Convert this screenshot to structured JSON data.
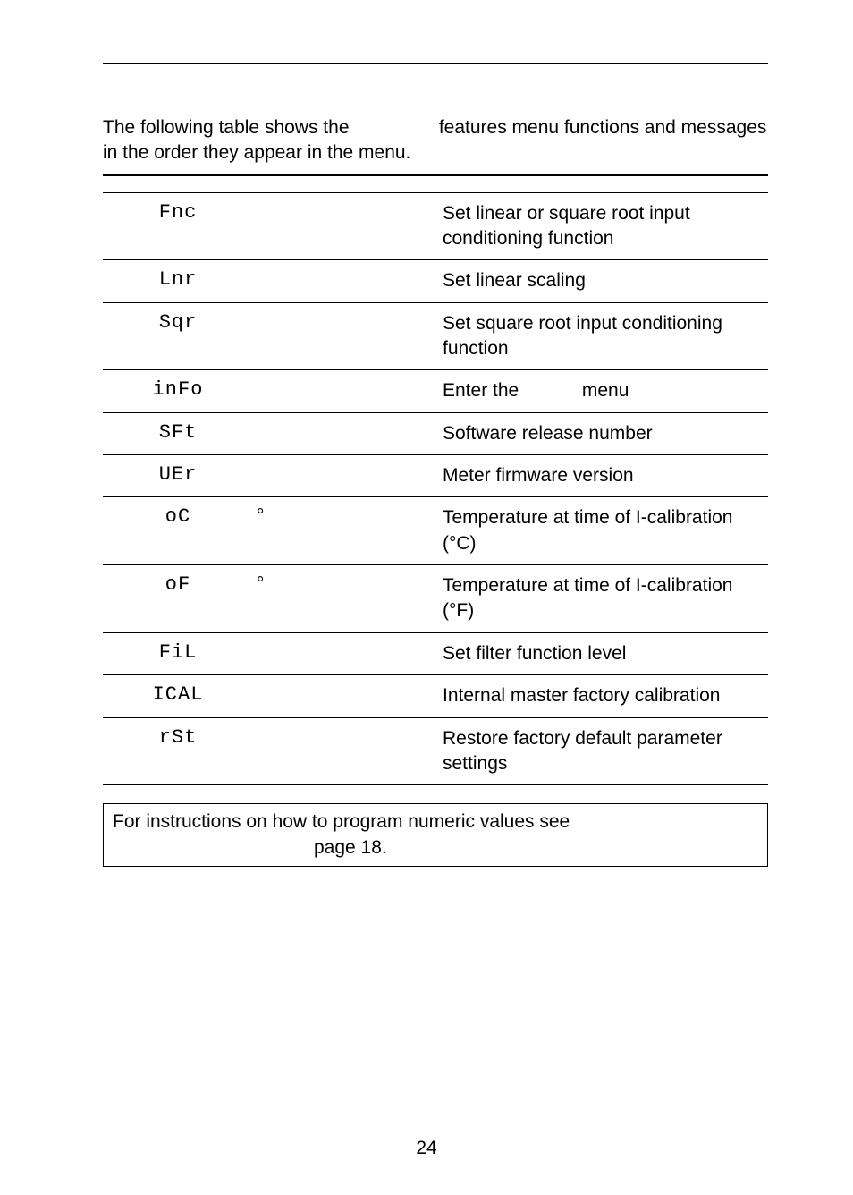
{
  "intro": {
    "line1_left": "The following table shows the",
    "line1_right": "features menu functions and messages",
    "line2": "in the order they appear in the menu."
  },
  "rows": [
    {
      "disp": "Fnc",
      "mid": "",
      "desc": "Set linear or square root input conditioning function"
    },
    {
      "disp": "Lnr",
      "mid": "",
      "desc": "Set linear scaling"
    },
    {
      "disp": "Sqr",
      "mid": "",
      "desc": "Set square root input conditioning function"
    },
    {
      "disp": "inFo",
      "mid": "",
      "desc_pre": "Enter the",
      "desc_post": "menu"
    },
    {
      "disp": "SFt",
      "mid": "",
      "desc": "Software release number"
    },
    {
      "disp": "UEr",
      "mid": "",
      "desc": "Meter firmware version"
    },
    {
      "disp": "oC",
      "mid": "°",
      "desc": "Temperature at time of I-calibration (°C)"
    },
    {
      "disp": "oF",
      "mid": "°",
      "desc": "Temperature at time of I-calibration (°F)"
    },
    {
      "disp": "FiL",
      "mid": "",
      "desc": "Set filter function level"
    },
    {
      "disp": "ICAL",
      "mid": "",
      "desc": "Internal master factory calibration"
    },
    {
      "disp": "rSt",
      "mid": "",
      "desc": "Restore factory default parameter settings"
    }
  ],
  "note": {
    "line1": "For instructions on how to program numeric values see",
    "line2": "page 18."
  },
  "page_number": "24"
}
